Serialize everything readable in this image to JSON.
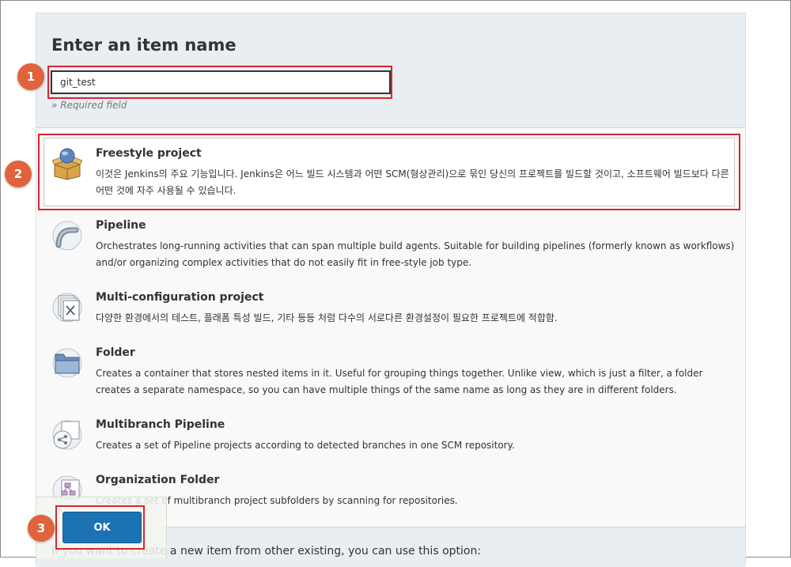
{
  "header": {
    "title": "Enter an item name",
    "name_input_value": "git_test",
    "required_note": "» Required field"
  },
  "items": [
    {
      "name": "Freestyle project",
      "desc": "이것은 Jenkins의 주요 기능입니다. Jenkins은 어느 빌드 시스템과 어떤 SCM(형상관리)으로 묶인 당신의 프로젝트를 빌드할 것이고, 소프트웨어 빌드보다 다른 어떤 것에 자주 사용될 수 있습니다.",
      "icon": "freestyle-project-icon",
      "selected": true
    },
    {
      "name": "Pipeline",
      "desc": "Orchestrates long-running activities that can span multiple build agents. Suitable for building pipelines (formerly known as workflows) and/or organizing complex activities that do not easily fit in free-style job type.",
      "icon": "pipeline-icon"
    },
    {
      "name": "Multi-configuration project",
      "desc": "다양한 환경에서의 테스트, 플래폼 특성 빌드, 기타 등등 처럼 다수의 서로다른 환경설정이 필요한 프로젝트에 적합함.",
      "icon": "multi-configuration-icon"
    },
    {
      "name": "Folder",
      "desc": "Creates a container that stores nested items in it. Useful for grouping things together. Unlike view, which is just a filter, a folder creates a separate namespace, so you can have multiple things of the same name as long as they are in different folders.",
      "icon": "folder-icon"
    },
    {
      "name": "Multibranch Pipeline",
      "desc": "Creates a set of Pipeline projects according to detected branches in one SCM repository.",
      "icon": "multibranch-pipeline-icon"
    },
    {
      "name": "Organization Folder",
      "desc": "Creates a set of multibranch project subfolders by scanning for repositories.",
      "icon": "organization-folder-icon"
    }
  ],
  "copy_section": {
    "text": "If you want to create a new item from other existing, you can use this option:"
  },
  "ok_button": {
    "label": "OK"
  },
  "annotations": [
    "1",
    "2",
    "3"
  ],
  "colors": {
    "highlight": "#d9252e",
    "badge": "#e0633c",
    "ok_button": "#1c73b3",
    "header_bg": "#e9eef2"
  }
}
